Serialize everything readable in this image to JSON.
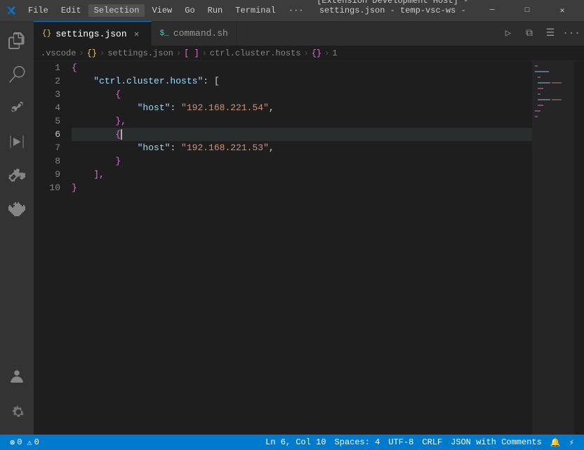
{
  "titlebar": {
    "logo_icon": "vscode-logo",
    "menu_items": [
      "File",
      "Edit",
      "Selection",
      "View",
      "Go",
      "Run",
      "Terminal"
    ],
    "more_icon": "...",
    "title": "[Extension Development Host] - settings.json - temp-vsc-ws - ...",
    "min_btn": "─",
    "max_btn": "□",
    "close_btn": "✕"
  },
  "tabs": [
    {
      "id": "settings",
      "icon": "{}",
      "icon_type": "json",
      "label": "settings.json",
      "active": true,
      "close_icon": "✕"
    },
    {
      "id": "command",
      "icon": "$",
      "icon_type": "bash",
      "label": "command.sh",
      "active": false,
      "close_icon": ""
    }
  ],
  "tab_actions": {
    "run_icon": "▶",
    "split_icon": "⧉",
    "layout_icon": "☰",
    "more_icon": "···"
  },
  "breadcrumb": {
    "items": [
      ".vscode",
      "{}",
      "settings.json",
      "[]",
      "ctrl.cluster.hosts",
      "{}",
      "1"
    ]
  },
  "editor": {
    "lines": [
      {
        "num": 1,
        "content": [
          {
            "text": "{",
            "class": "json-brace"
          }
        ]
      },
      {
        "num": 2,
        "content": [
          {
            "text": "    ",
            "class": ""
          },
          {
            "text": "\"ctrl.cluster.hosts\"",
            "class": "json-key"
          },
          {
            "text": ": [",
            "class": "json-colon"
          }
        ]
      },
      {
        "num": 3,
        "content": [
          {
            "text": "        {",
            "class": "json-brace"
          }
        ]
      },
      {
        "num": 4,
        "content": [
          {
            "text": "            ",
            "class": ""
          },
          {
            "text": "\"host\"",
            "class": "json-key"
          },
          {
            "text": ": ",
            "class": "json-colon"
          },
          {
            "text": "\"192.168.221.54\"",
            "class": "json-string"
          },
          {
            "text": ",",
            "class": "json-comma"
          }
        ]
      },
      {
        "num": 5,
        "content": [
          {
            "text": "        },",
            "class": "json-brace"
          }
        ]
      },
      {
        "num": 6,
        "content": [
          {
            "text": "        {",
            "class": "json-brace"
          }
        ],
        "current": true
      },
      {
        "num": 7,
        "content": [
          {
            "text": "            ",
            "class": ""
          },
          {
            "text": "\"host\"",
            "class": "json-key"
          },
          {
            "text": ": ",
            "class": "json-colon"
          },
          {
            "text": "\"192.168.221.53\"",
            "class": "json-string"
          },
          {
            "text": ",",
            "class": "json-comma"
          }
        ]
      },
      {
        "num": 8,
        "content": [
          {
            "text": "        }",
            "class": "json-brace"
          }
        ]
      },
      {
        "num": 9,
        "content": [
          {
            "text": "    ],",
            "class": "json-bracket"
          }
        ]
      },
      {
        "num": 10,
        "content": [
          {
            "text": "}",
            "class": "json-brace"
          }
        ]
      }
    ],
    "cursor_line": 6,
    "cursor_col": 10
  },
  "statusbar": {
    "left": [
      {
        "id": "errors",
        "icon": "⊗",
        "count": "0",
        "label": ""
      },
      {
        "id": "warnings",
        "icon": "⚠",
        "count": "0",
        "label": ""
      }
    ],
    "right": [
      {
        "id": "ln-col",
        "label": "Ln 6, Col 10"
      },
      {
        "id": "spaces",
        "label": "Spaces: 4"
      },
      {
        "id": "encoding",
        "label": "UTF-8"
      },
      {
        "id": "eol",
        "label": "CRLF"
      },
      {
        "id": "language",
        "label": "JSON with Comments"
      },
      {
        "id": "feedback",
        "icon": "🔔"
      },
      {
        "id": "remote",
        "icon": "⚡"
      }
    ]
  },
  "activity_bar": {
    "items": [
      {
        "id": "explorer",
        "icon": "⧉",
        "active": false
      },
      {
        "id": "search",
        "icon": "🔍",
        "active": false
      },
      {
        "id": "source-control",
        "icon": "⎇",
        "active": false
      },
      {
        "id": "run",
        "icon": "▶",
        "active": false
      },
      {
        "id": "extensions",
        "icon": "⊞",
        "active": false
      },
      {
        "id": "remote-explorer",
        "icon": "🖥",
        "active": false
      }
    ],
    "bottom_items": [
      {
        "id": "accounts",
        "icon": "👤"
      },
      {
        "id": "settings",
        "icon": "⚙"
      }
    ]
  }
}
